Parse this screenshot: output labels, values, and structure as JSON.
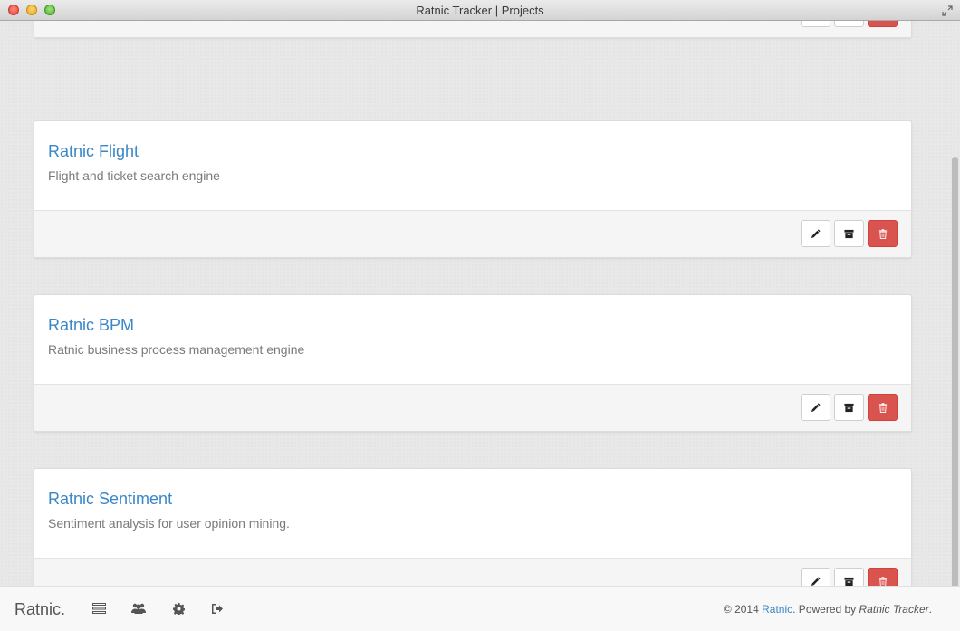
{
  "window": {
    "title": "Ratnic Tracker | Projects"
  },
  "projects": [
    {
      "name": "",
      "description": ""
    },
    {
      "name": "Ratnic Flight",
      "description": "Flight and ticket search engine"
    },
    {
      "name": "Ratnic BPM",
      "description": "Ratnic business process management engine"
    },
    {
      "name": "Ratnic Sentiment",
      "description": "Sentiment analysis for user opinion mining."
    }
  ],
  "icons": {
    "edit": "pencil-icon",
    "archive": "archive-icon",
    "delete": "trash-icon",
    "nav_projects": "list-icon",
    "nav_users": "users-icon",
    "nav_settings": "gear-icon",
    "nav_logout": "sign-out-icon"
  },
  "colors": {
    "link": "#3a87c7",
    "danger": "#d9534f"
  },
  "footer": {
    "brand": "Ratnic.",
    "copy_prefix": "© 2014 ",
    "copy_link": "Ratnic",
    "copy_middle": ". Powered by ",
    "copy_product": "Ratnic Tracker",
    "copy_suffix": "."
  }
}
